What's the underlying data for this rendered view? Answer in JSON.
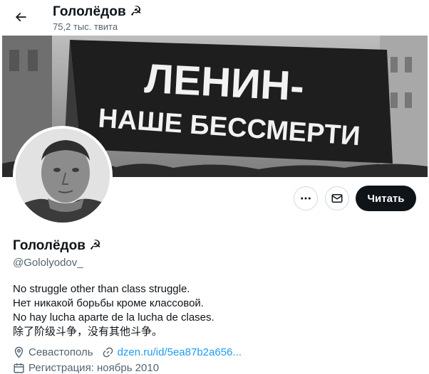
{
  "header": {
    "title": "Гололёдов ☭",
    "tweet_count": "75,2 тыс. твита"
  },
  "banner": {
    "line1": "ЛЕНИН-",
    "line2": "НАШЕ БЕССМЕРТИ"
  },
  "actions": {
    "more_icon": "more-horizontal-icon",
    "message_icon": "envelope-icon",
    "follow_label": "Читать"
  },
  "profile": {
    "name": "Гололёдов ☭",
    "handle": "@Gololyodov_",
    "bio": [
      "No struggle other than class struggle.",
      "Нет никакой борьбы кроме классовой.",
      "No hay lucha aparte de la lucha de clases.",
      "除了阶级斗争，没有其他斗争。"
    ],
    "location": "Севастополь",
    "website": "dzen.ru/id/5ea87b2a656...",
    "joined": "Регистрация: ноябрь 2010"
  },
  "colors": {
    "accent": "#1d9bf0",
    "text_primary": "#0f1419",
    "text_secondary": "#536471",
    "border": "#cfd9de",
    "follow_bg": "#0f1419"
  }
}
